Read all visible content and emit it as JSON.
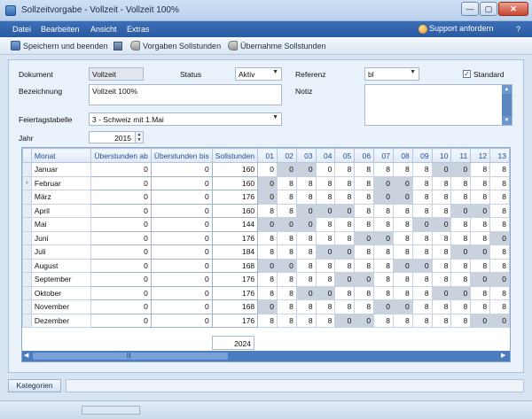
{
  "window": {
    "title": "Sollzeitvorgabe - Vollzeit - Vollzeit 100%",
    "min": "—",
    "max": "▢",
    "close": "✕"
  },
  "menu": {
    "items": [
      "Datei",
      "Bearbeiten",
      "Ansicht",
      "Extras"
    ],
    "support": "Support anfordern",
    "help": "?"
  },
  "toolbar": {
    "save_close": "Speichern und beenden",
    "vorgaben": "Vorgaben Sollstunden",
    "uebernahme": "Übernahme Sollstunden"
  },
  "form": {
    "dokument_label": "Dokument",
    "dokument_value": "Vollzeit",
    "status_label": "Status",
    "status_value": "Aktiv",
    "referenz_label": "Referenz",
    "referenz_value": "bl",
    "standard_label": "Standard",
    "standard_checked": "✓",
    "bezeichnung_label": "Bezeichnung",
    "bezeichnung_value": "Vollzeit 100%",
    "notiz_label": "Notiz",
    "feiertag_label": "Feiertagstabelle",
    "feiertag_value": "3 - Schweiz mit 1.Mai",
    "jahr_label": "Jahr",
    "jahr_value": "2015"
  },
  "grid": {
    "headers": [
      "Monat",
      "Überstunden ab",
      "Überstunden bis",
      "Sollstunden",
      "01",
      "02",
      "03",
      "04",
      "05",
      "06",
      "07",
      "08",
      "09",
      "10",
      "11",
      "12",
      "13"
    ],
    "current_row_marker": "›",
    "rows": [
      {
        "month": "Januar",
        "ab": "0",
        "bis": "0",
        "soll": "160",
        "days": [
          "0",
          "0",
          "0",
          "0",
          "8",
          "8",
          "8",
          "8",
          "8",
          "0",
          "0",
          "8",
          "8"
        ],
        "we": [
          0,
          1,
          1,
          0,
          0,
          0,
          0,
          0,
          0,
          1,
          1,
          0,
          0
        ]
      },
      {
        "month": "Februar",
        "ab": "0",
        "bis": "0",
        "soll": "160",
        "days": [
          "0",
          "8",
          "8",
          "8",
          "8",
          "8",
          "0",
          "0",
          "8",
          "8",
          "8",
          "8",
          "8"
        ],
        "we": [
          1,
          0,
          0,
          0,
          0,
          0,
          1,
          1,
          0,
          0,
          0,
          0,
          0
        ]
      },
      {
        "month": "März",
        "ab": "0",
        "bis": "0",
        "soll": "176",
        "days": [
          "0",
          "8",
          "8",
          "8",
          "8",
          "8",
          "0",
          "0",
          "8",
          "8",
          "8",
          "8",
          "8"
        ],
        "we": [
          1,
          0,
          0,
          0,
          0,
          0,
          1,
          1,
          0,
          0,
          0,
          0,
          0
        ]
      },
      {
        "month": "April",
        "ab": "0",
        "bis": "0",
        "soll": "160",
        "days": [
          "8",
          "8",
          "0",
          "0",
          "0",
          "8",
          "8",
          "8",
          "8",
          "8",
          "0",
          "0",
          "8"
        ],
        "we": [
          0,
          0,
          1,
          1,
          1,
          0,
          0,
          0,
          0,
          0,
          1,
          1,
          0
        ]
      },
      {
        "month": "Mai",
        "ab": "0",
        "bis": "0",
        "soll": "144",
        "days": [
          "0",
          "0",
          "0",
          "8",
          "8",
          "8",
          "8",
          "8",
          "0",
          "0",
          "8",
          "8",
          "8"
        ],
        "we": [
          1,
          1,
          1,
          0,
          0,
          0,
          0,
          0,
          1,
          1,
          0,
          0,
          0
        ]
      },
      {
        "month": "Juni",
        "ab": "0",
        "bis": "0",
        "soll": "176",
        "days": [
          "8",
          "8",
          "8",
          "8",
          "8",
          "0",
          "0",
          "8",
          "8",
          "8",
          "8",
          "8",
          "0"
        ],
        "we": [
          0,
          0,
          0,
          0,
          0,
          1,
          1,
          0,
          0,
          0,
          0,
          0,
          1
        ]
      },
      {
        "month": "Juli",
        "ab": "0",
        "bis": "0",
        "soll": "184",
        "days": [
          "8",
          "8",
          "8",
          "0",
          "0",
          "8",
          "8",
          "8",
          "8",
          "8",
          "0",
          "0",
          "8"
        ],
        "we": [
          0,
          0,
          0,
          1,
          1,
          0,
          0,
          0,
          0,
          0,
          1,
          1,
          0
        ]
      },
      {
        "month": "August",
        "ab": "0",
        "bis": "0",
        "soll": "168",
        "days": [
          "0",
          "0",
          "8",
          "8",
          "8",
          "8",
          "8",
          "0",
          "0",
          "8",
          "8",
          "8",
          "8"
        ],
        "we": [
          1,
          1,
          0,
          0,
          0,
          0,
          0,
          1,
          1,
          0,
          0,
          0,
          0
        ]
      },
      {
        "month": "September",
        "ab": "0",
        "bis": "0",
        "soll": "176",
        "days": [
          "8",
          "8",
          "8",
          "8",
          "0",
          "0",
          "8",
          "8",
          "8",
          "8",
          "8",
          "0",
          "0"
        ],
        "we": [
          0,
          0,
          0,
          0,
          1,
          1,
          0,
          0,
          0,
          0,
          0,
          1,
          1
        ]
      },
      {
        "month": "Oktober",
        "ab": "0",
        "bis": "0",
        "soll": "176",
        "days": [
          "8",
          "8",
          "0",
          "0",
          "8",
          "8",
          "8",
          "8",
          "8",
          "0",
          "0",
          "8",
          "8"
        ],
        "we": [
          0,
          0,
          1,
          1,
          0,
          0,
          0,
          0,
          0,
          1,
          1,
          0,
          0
        ]
      },
      {
        "month": "November",
        "ab": "0",
        "bis": "0",
        "soll": "168",
        "days": [
          "0",
          "8",
          "8",
          "8",
          "8",
          "8",
          "0",
          "0",
          "8",
          "8",
          "8",
          "8",
          "8"
        ],
        "we": [
          1,
          0,
          0,
          0,
          0,
          0,
          1,
          1,
          0,
          0,
          0,
          0,
          0
        ]
      },
      {
        "month": "Dezember",
        "ab": "0",
        "bis": "0",
        "soll": "176",
        "days": [
          "8",
          "8",
          "8",
          "8",
          "0",
          "0",
          "8",
          "8",
          "8",
          "8",
          "8",
          "0",
          "0"
        ],
        "we": [
          0,
          0,
          0,
          0,
          1,
          1,
          0,
          0,
          0,
          0,
          0,
          1,
          1
        ]
      }
    ],
    "sum_value": "2024"
  },
  "bottom": {
    "tab_label": "Kategorien"
  },
  "colors": {
    "menubar": "#2b5a9f",
    "weekend_cell": "#c9d2dd",
    "header_text": "#1e4f9a"
  }
}
